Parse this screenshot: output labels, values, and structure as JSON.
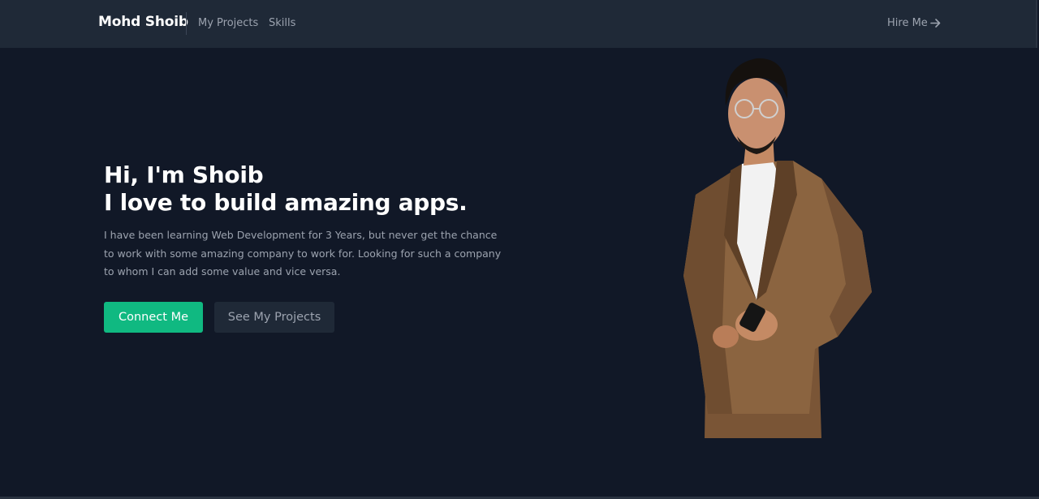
{
  "nav": {
    "brand": "Mohd Shoib",
    "links": [
      {
        "label": "My Projects"
      },
      {
        "label": "Skills"
      }
    ],
    "hire_label": "Hire Me",
    "hire_icon": "arrow-right-icon"
  },
  "hero": {
    "greeting": "Hi, I'm Shoib",
    "tagline": "I love to build amazing apps.",
    "description": "I have been learning Web Development for 3 Years, but never get the chance to work with some amazing company to work for. Looking for such a company to whom I can add some value and vice versa.",
    "primary_button": "Connect Me",
    "secondary_button": "See My Projects"
  },
  "colors": {
    "background": "#111827",
    "navbar": "#1f2937",
    "accent": "#10b981",
    "muted_text": "#9ca3af"
  }
}
